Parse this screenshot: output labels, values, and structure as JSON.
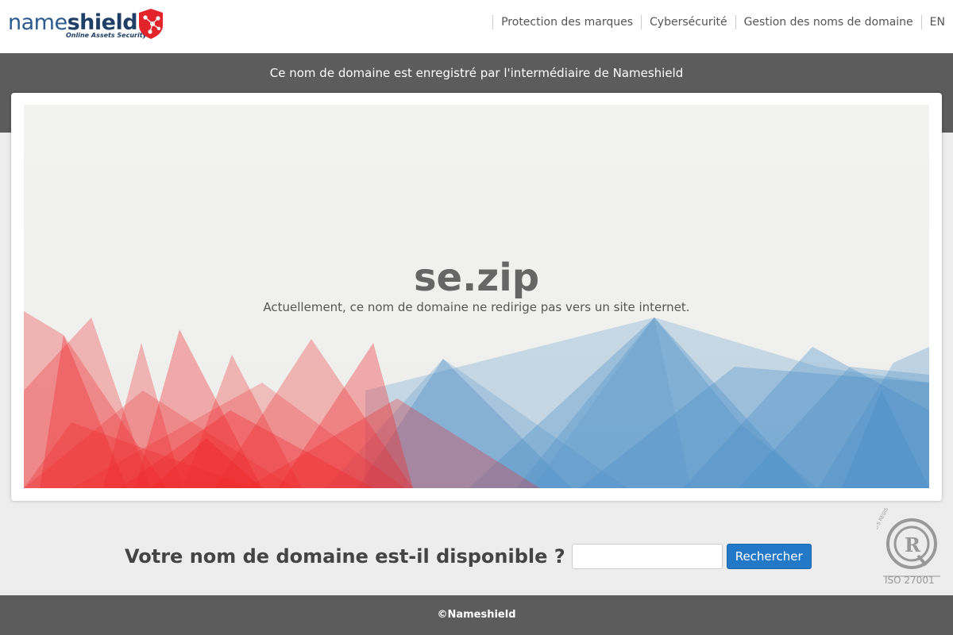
{
  "brand": {
    "logo_prefix": "name",
    "logo_suffix": "shield",
    "tagline": "Online Assets Security",
    "primary_color": "#1f3f66",
    "shield_color": "#e3242b"
  },
  "nav": {
    "items": [
      {
        "label": "Protection des marques"
      },
      {
        "label": "Cybersécurité"
      },
      {
        "label": "Gestion des noms de domaine"
      },
      {
        "label": "EN"
      }
    ]
  },
  "banner": {
    "text": "Ce nom de domaine est enregistré par l'intermédiaire de Nameshield"
  },
  "hero": {
    "domain": "se.zip",
    "subtitle": "Actuellement, ce nom de domaine ne redirige pas vers un site internet."
  },
  "search": {
    "question": "Votre nom de domaine est-il disponible ?",
    "input_value": "",
    "button_label": "Rechercher",
    "button_color": "#2378c8"
  },
  "certification": {
    "ring_text": "LLOYD'S REGISTER LRQA",
    "label": "ISO 27001"
  },
  "footer": {
    "copyright": "©Nameshield"
  }
}
